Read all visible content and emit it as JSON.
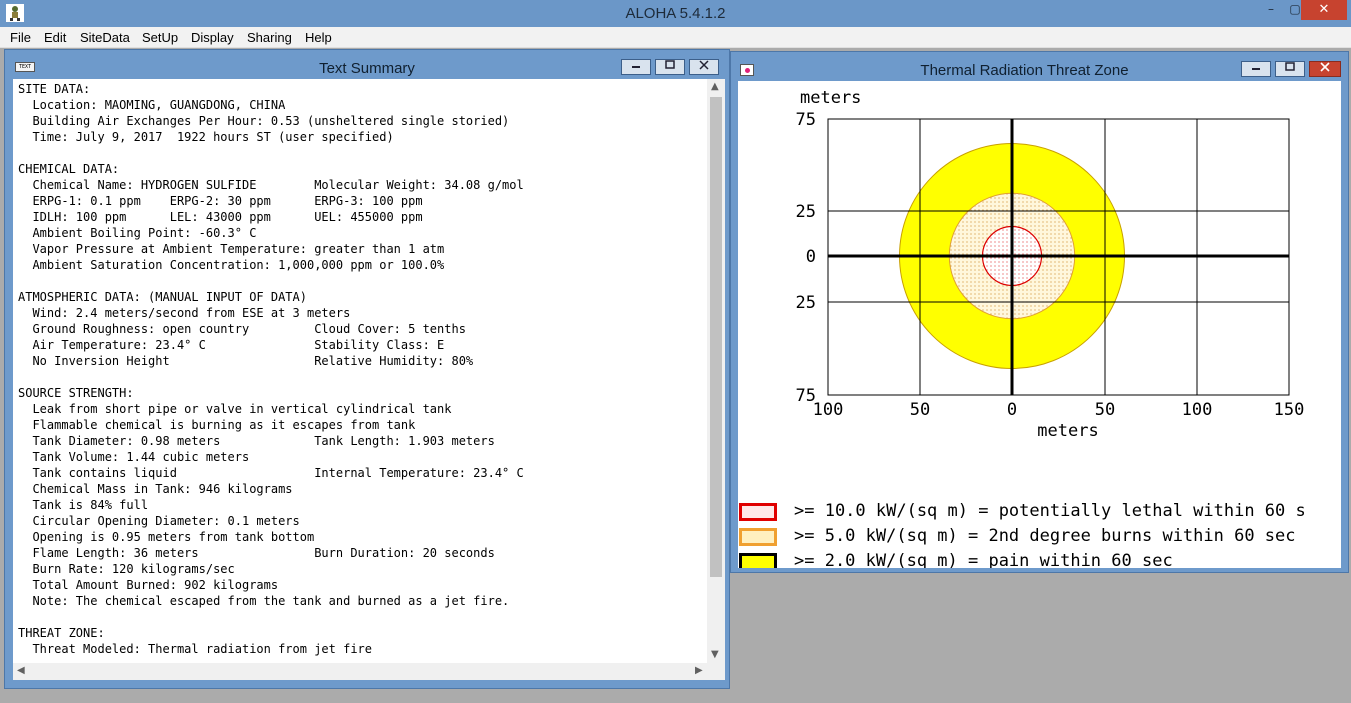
{
  "app": {
    "title": "ALOHA 5.4.1.2",
    "controls": {
      "minimize": "–",
      "maximize": "▢",
      "close": "✕"
    }
  },
  "menu": [
    "File",
    "Edit",
    "SiteData",
    "SetUp",
    "Display",
    "Sharing",
    "Help"
  ],
  "text_summary_window": {
    "title": "Text Summary",
    "icon_label": "TEXT",
    "lines": [
      "SITE DATA:",
      "  Location: MAOMING, GUANGDONG, CHINA",
      "  Building Air Exchanges Per Hour: 0.53 (unsheltered single storied)",
      "  Time: July 9, 2017  1922 hours ST (user specified)",
      "",
      "CHEMICAL DATA:",
      "  Chemical Name: HYDROGEN SULFIDE        Molecular Weight: 34.08 g/mol",
      "  ERPG-1: 0.1 ppm    ERPG-2: 30 ppm      ERPG-3: 100 ppm",
      "  IDLH: 100 ppm      LEL: 43000 ppm      UEL: 455000 ppm",
      "  Ambient Boiling Point: -60.3° C",
      "  Vapor Pressure at Ambient Temperature: greater than 1 atm",
      "  Ambient Saturation Concentration: 1,000,000 ppm or 100.0%",
      "",
      "ATMOSPHERIC DATA: (MANUAL INPUT OF DATA)",
      "  Wind: 2.4 meters/second from ESE at 3 meters",
      "  Ground Roughness: open country         Cloud Cover: 5 tenths",
      "  Air Temperature: 23.4° C               Stability Class: E",
      "  No Inversion Height                    Relative Humidity: 80%",
      "",
      "SOURCE STRENGTH:",
      "  Leak from short pipe or valve in vertical cylindrical tank",
      "  Flammable chemical is burning as it escapes from tank",
      "  Tank Diameter: 0.98 meters             Tank Length: 1.903 meters",
      "  Tank Volume: 1.44 cubic meters",
      "  Tank contains liquid                   Internal Temperature: 23.4° C",
      "  Chemical Mass in Tank: 946 kilograms",
      "  Tank is 84% full",
      "  Circular Opening Diameter: 0.1 meters",
      "  Opening is 0.95 meters from tank bottom",
      "  Flame Length: 36 meters                Burn Duration: 20 seconds",
      "  Burn Rate: 120 kilograms/sec",
      "  Total Amount Burned: 902 kilograms",
      "  Note: The chemical escaped from the tank and burned as a jet fire.",
      "",
      "THREAT ZONE:",
      "  Threat Modeled: Thermal radiation from jet fire"
    ]
  },
  "threat_zone_window": {
    "title": "Thermal Radiation Threat Zone",
    "y_axis_title": "meters",
    "x_axis_title": "meters",
    "y_ticks": [
      "75",
      "25",
      "0",
      "25",
      "75"
    ],
    "x_ticks": [
      "100",
      "50",
      "0",
      "50",
      "100",
      "150"
    ],
    "zones": [
      {
        "radius_m": 61,
        "color": "#ffff00",
        "border": "#cc9900",
        "pattern": "solid"
      },
      {
        "radius_m": 34,
        "color": "#fff3cc",
        "border": "#e0a030",
        "pattern": "dots"
      },
      {
        "radius_m": 16,
        "color": "#ffffff",
        "border": "#dd0000",
        "pattern": "red-dots"
      }
    ],
    "legend": [
      {
        "label": ">= 10.0 kW/(sq m) = potentially lethal within 60 s",
        "border": "#e00000",
        "fill": "#ffe8e8"
      },
      {
        "label": ">= 5.0 kW/(sq m) = 2nd degree burns within 60 sec",
        "border": "#f0a030",
        "fill": "#fff0c0"
      },
      {
        "label": ">= 2.0 kW/(sq m) = pain within 60 sec",
        "border": "#000000",
        "fill": "#ffff00"
      }
    ]
  }
}
